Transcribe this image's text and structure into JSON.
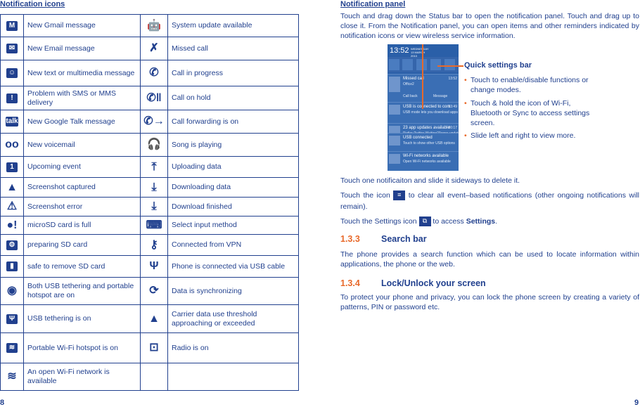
{
  "left_page": {
    "heading": "Notification icons",
    "rows": [
      {
        "icon1": "gmail-icon",
        "glyph1": "M",
        "label1": "New Gmail message",
        "icon2": "system-update-icon",
        "glyph2": "🤖",
        "label2": "System update available"
      },
      {
        "icon1": "email-icon",
        "glyph1": "✉",
        "label1": "New Email message",
        "icon2": "missed-call-icon",
        "glyph2": "✗",
        "label2": "Missed call"
      },
      {
        "icon1": "sms-icon",
        "glyph1": "☺",
        "label1": "New text or multimedia message",
        "icon2": "call-in-progress-icon",
        "glyph2": "✆",
        "label2": "Call in progress"
      },
      {
        "icon1": "sms-problem-icon",
        "glyph1": "!",
        "label1": "Problem with SMS or MMS delivery",
        "icon2": "call-on-hold-icon",
        "glyph2": "✆‖",
        "label2": "Call on hold"
      },
      {
        "icon1": "google-talk-icon",
        "glyph1": "talk",
        "label1": "New Google Talk message",
        "icon2": "call-forwarding-icon",
        "glyph2": "✆→",
        "label2": "Call forwarding is on"
      },
      {
        "icon1": "voicemail-icon",
        "glyph1": "oo",
        "label1": "New voicemail",
        "icon2": "headphones-icon",
        "glyph2": "🎧",
        "label2": "Song is playing"
      },
      {
        "icon1": "calendar-icon",
        "glyph1": "1",
        "label1": "Upcoming event",
        "icon2": "upload-icon",
        "glyph2": "⤒",
        "label2": "Uploading data"
      },
      {
        "icon1": "screenshot-icon",
        "glyph1": "▲",
        "label1": "Screenshot captured",
        "icon2": "download-icon",
        "glyph2": "⤓",
        "label2": "Downloading data"
      },
      {
        "icon1": "screenshot-error-icon",
        "glyph1": "⚠",
        "label1": "Screenshot error",
        "icon2": "download-finished-icon",
        "glyph2": "⤓",
        "label2": "Download finished"
      },
      {
        "icon1": "sd-card-full-icon",
        "glyph1": "●!",
        "label1": "microSD card is full",
        "icon2": "keyboard-icon",
        "glyph2": "⌨",
        "label2": "Select input method"
      },
      {
        "icon1": "sd-card-preparing-icon",
        "glyph1": "⚙",
        "label1": "preparing SD card",
        "icon2": "vpn-key-icon",
        "glyph2": "⚷",
        "label2": " Connected from VPN"
      },
      {
        "icon1": "sd-card-icon",
        "glyph1": "▮",
        "label1": "safe to remove SD card",
        "icon2": "usb-icon",
        "glyph2": "Ψ",
        "label2": "Phone is connected via USB cable"
      },
      {
        "icon1": "hotspot-usb-icon",
        "glyph1": "◉",
        "label1": "Both USB tethering and portable hotspot are on",
        "icon2": "sync-icon",
        "glyph2": "⟳",
        "label2": "Data is synchronizing"
      },
      {
        "icon1": "usb-tethering-icon",
        "glyph1": "Ψ",
        "label1": "USB tethering is on",
        "icon2": "warning-icon",
        "glyph2": "▲",
        "label2": "Carrier data use threshold approaching or exceeded"
      },
      {
        "icon1": "wifi-hotspot-icon",
        "glyph1": "≋",
        "label1": "Portable Wi-Fi hotspot is on",
        "icon2": "radio-icon",
        "glyph2": "⊡",
        "label2": "Radio is on"
      },
      {
        "icon1": "open-wifi-icon",
        "glyph1": "≋",
        "label1": "An open Wi-Fi network is available",
        "icon2": "",
        "glyph2": "",
        "label2": ""
      }
    ],
    "page_number": "8"
  },
  "right_page": {
    "heading": "Notification panel",
    "intro": "Touch and drag down the Status bar to open the notification panel. Touch and drag up to close it. From the Notification panel, you can open items and other reminders indicated by notification icons or view wireless service information.",
    "screenshot": {
      "time": "13:52",
      "date": "WEDNESDAY 13 MARCH 2013",
      "notifications": [
        {
          "title": "Missed call",
          "sub": "Office2",
          "time": "13:52"
        },
        {
          "title": "USB is connected to com",
          "sub": "USB mode lets you download apps",
          "time": "13:49"
        },
        {
          "title": "23 app updates available",
          "sub": "Picfizy,Twitter Waiting23apps update",
          "time": "00:17"
        },
        {
          "title": "USB connected",
          "sub": "Touch to show other USB options",
          "time": ""
        },
        {
          "title": "Wi-Fi networks available",
          "sub": "Open Wi-Fi networks available",
          "time": ""
        }
      ],
      "call_back": "Call back",
      "message": "Message"
    },
    "callout": "Quick settings bar",
    "bullets": [
      "Touch to enable/disable functions or change modes.",
      "Touch & hold the icon of Wi-Fi, Bluetooth or Sync to access settings screen.",
      "Slide left and right to view more."
    ],
    "p_delete": "Touch one notificaiton and slide it sideways to delete it.",
    "p_clear_before": "Touch the icon",
    "p_clear_after": "to clear all event–based notifications (other ongoing notifications will remain).",
    "p_settings_before": "Touch the Settings icon",
    "p_settings_mid": "to access",
    "p_settings_bold": "Settings",
    "p_settings_end": ".",
    "sections": [
      {
        "number": "1.3.3",
        "title": "Search bar",
        "text": "The phone provides a search function which can be used to locate information within applications, the phone or the web."
      },
      {
        "number": "1.3.4",
        "title": "Lock/Unlock your screen",
        "text": "To protect your phone and privacy, you can lock the phone screen by creating a variety of patterns, PIN or password etc."
      }
    ],
    "page_number": "9"
  },
  "colors": {
    "text": "#21408e",
    "accent": "#e8692a"
  }
}
